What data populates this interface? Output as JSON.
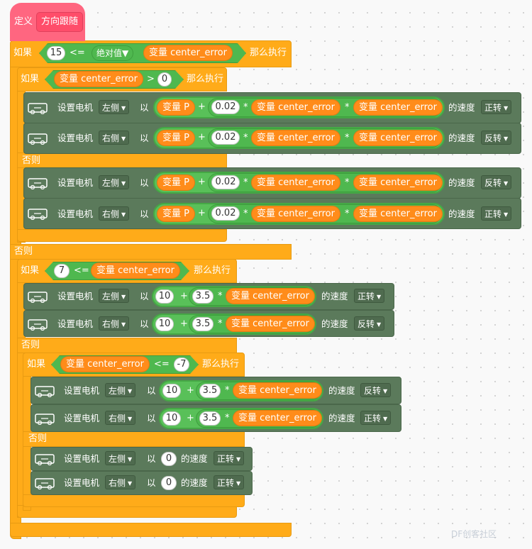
{
  "define": {
    "label": "定义",
    "name": "方向跟随"
  },
  "ctrl": {
    "if": "如果",
    "then": "那么执行",
    "else": "否则"
  },
  "motor": {
    "set": "设置电机",
    "by": "以",
    "speed": "的速度"
  },
  "dir": {
    "left": "左侧",
    "right": "右侧"
  },
  "rot": {
    "fwd": "正转",
    "rev": "反转"
  },
  "ops": {
    "le": "<=",
    "gt": ">",
    "plus": "+",
    "times": "*"
  },
  "fn": {
    "abs": "绝对值"
  },
  "vars": {
    "err": "变量 center_error",
    "p": "变量 P"
  },
  "nums": {
    "n15": "15",
    "n0": "0",
    "n002": "0.02",
    "n7": "7",
    "n10": "10",
    "n35": "3.5",
    "nm7": "-7"
  },
  "icons": {
    "dropdown": "caret-down-icon",
    "motor": "motor-icon"
  },
  "colors": {
    "define": "#ff6680",
    "control": "#ffab19",
    "operator": "#59c059",
    "variable": "#ff8c1a",
    "motor": "#5b7a5b"
  },
  "watermark": "DF创客社区"
}
